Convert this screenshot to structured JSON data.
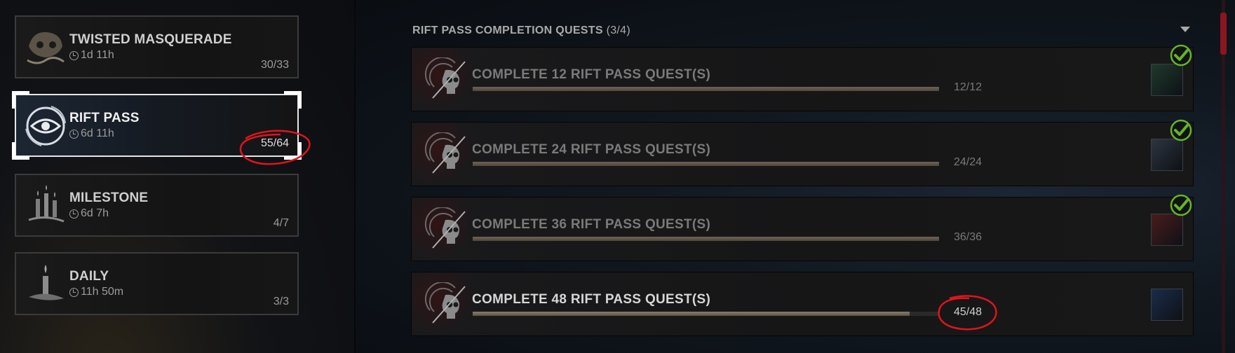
{
  "events": [
    {
      "title": "TWISTED MASQUERADE",
      "time": "1d 11h",
      "count": "30/33",
      "icon": "mask-icon",
      "active": false
    },
    {
      "title": "RIFT PASS",
      "time": "6d 11h",
      "count": "55/64",
      "icon": "rift-eye-icon",
      "active": true
    },
    {
      "title": "MILESTONE",
      "time": "6d 7h",
      "count": "4/7",
      "icon": "candles-icon",
      "active": false
    },
    {
      "title": "DAILY",
      "time": "11h 50m",
      "count": "3/3",
      "icon": "candle-icon",
      "active": false
    }
  ],
  "quests_panel": {
    "header": "RIFT PASS COMPLETION QUESTS",
    "header_count": "(3/4)",
    "quests": [
      {
        "title": "COMPLETE 12 RIFT PASS QUEST(S)",
        "count": "12/12",
        "progress": 1.0,
        "completed": true,
        "reward_color": "#1f3a2c"
      },
      {
        "title": "COMPLETE 24 RIFT PASS QUEST(S)",
        "count": "24/24",
        "progress": 1.0,
        "completed": true,
        "reward_color": "#2d3540"
      },
      {
        "title": "COMPLETE 36 RIFT PASS QUEST(S)",
        "count": "36/36",
        "progress": 1.0,
        "completed": true,
        "reward_color": "#4a1c1c"
      },
      {
        "title": "COMPLETE 48 RIFT PASS QUEST(S)",
        "count": "45/48",
        "progress": 0.9375,
        "completed": false,
        "reward_color": "#1b2c4a"
      }
    ]
  },
  "colors": {
    "accent_red": "#8c1520",
    "check_green": "#66b32e",
    "annotation_red": "#e0141e"
  }
}
